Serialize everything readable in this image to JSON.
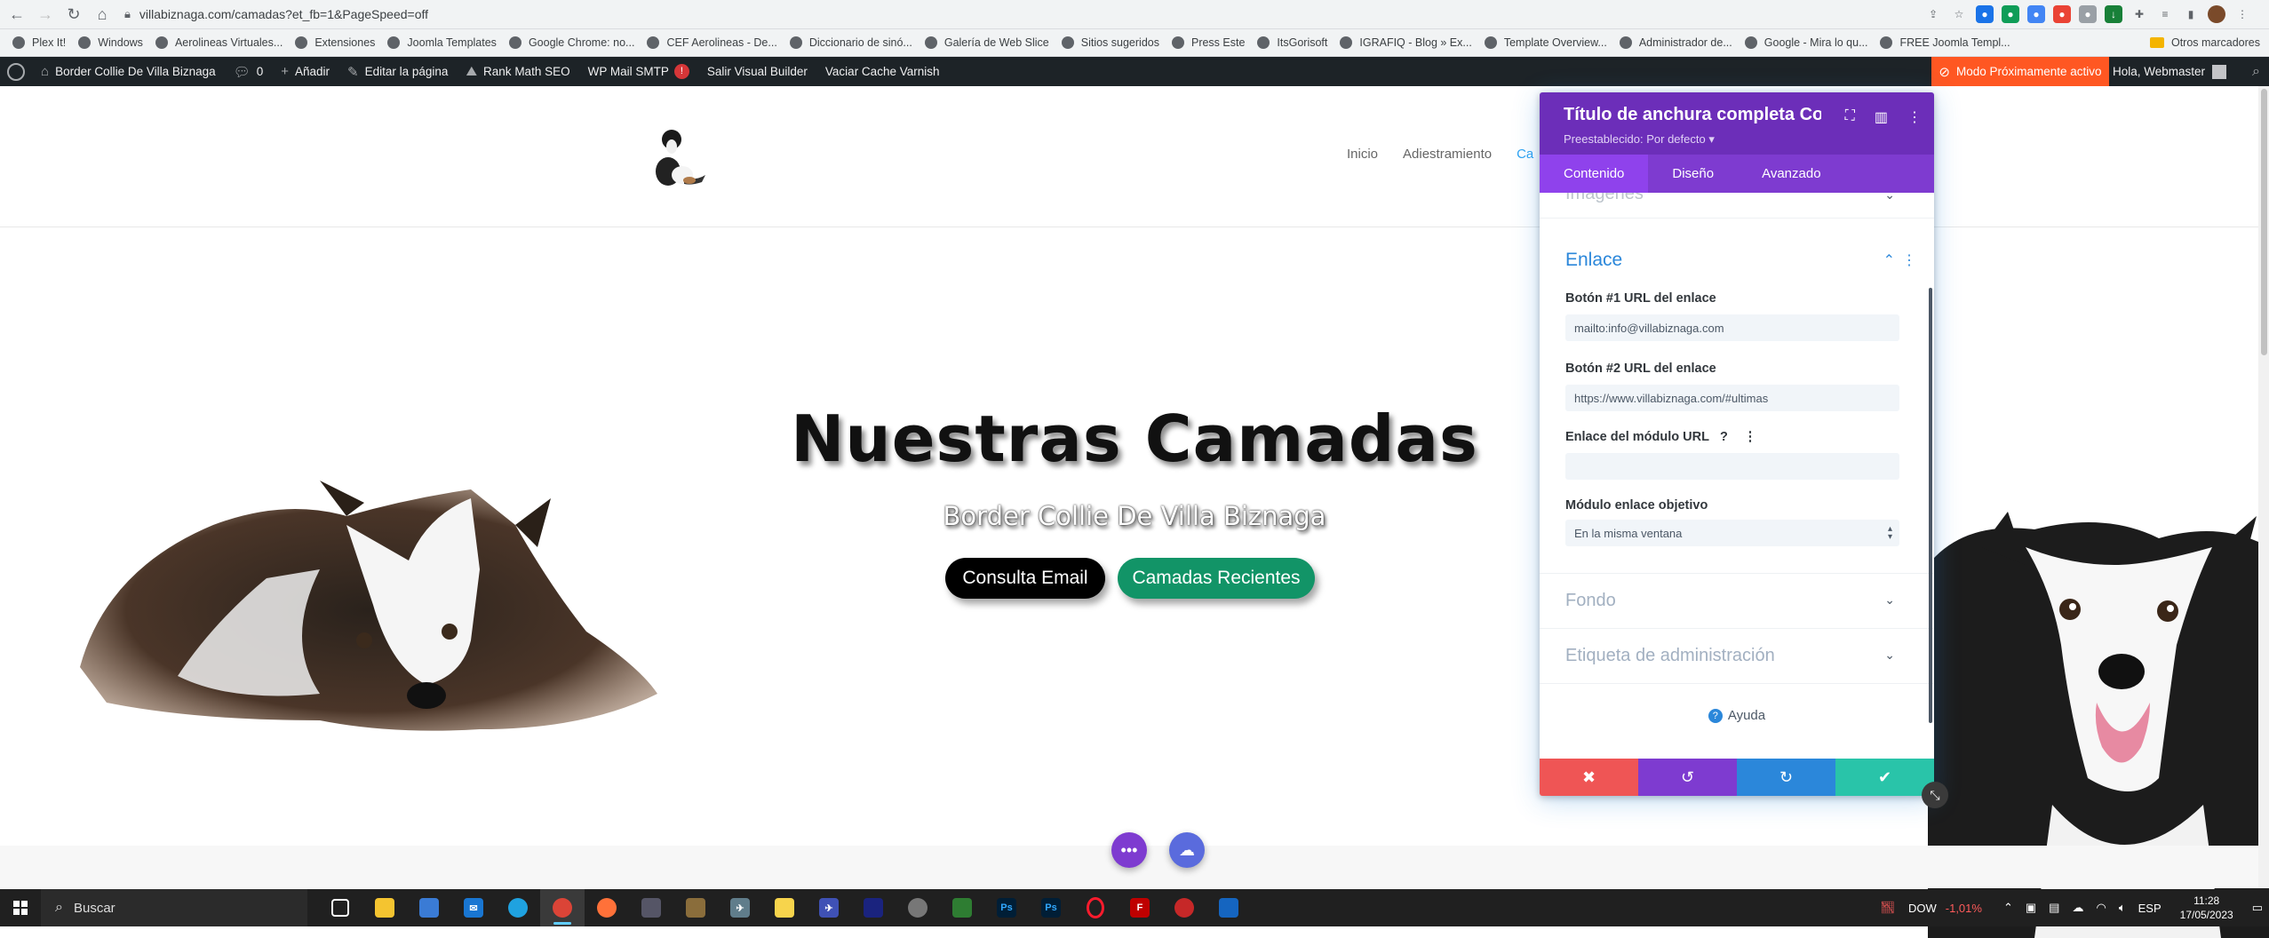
{
  "browser": {
    "url": "villabiznaga.com/camadas?et_fb=1&PageSpeed=off",
    "bookmarks": [
      "Plex It!",
      "Windows",
      "Aerolineas Virtuales...",
      "Extensiones",
      "Joomla Templates",
      "Google Chrome: no...",
      "CEF Aerolineas - De...",
      "Diccionario de sinó...",
      "Galería de Web Slice",
      "Sitios sugeridos",
      "Press Este",
      "ItsGorisoft",
      "IGRAFIQ - Blog » Ex...",
      "Template Overview...",
      "Administrador de...",
      "Google - Mira lo qu...",
      "FREE Joomla Templ..."
    ],
    "other_bookmarks": "Otros marcadores"
  },
  "wpbar": {
    "site_name": "Border Collie De Villa Biznaga",
    "comments_count": "0",
    "add_new": "Añadir",
    "edit_page": "Editar la página",
    "rank_math": "Rank Math SEO",
    "wp_mail": "WP Mail SMTP",
    "wp_mail_badge": "!",
    "exit_builder": "Salir Visual Builder",
    "clear_cache": "Vaciar Cache Varnish",
    "coming_soon": "Modo Próximamente activo",
    "greeting": "Hola, Webmaster"
  },
  "nav": {
    "items": [
      "Inicio",
      "Adiestramiento",
      "Ca"
    ]
  },
  "hero": {
    "title": "Nuestras Camadas",
    "subtitle": "Border Collie De Villa Biznaga",
    "button1": "Consulta Email",
    "button2": "Camadas Recientes"
  },
  "modal": {
    "title": "Título de anchura completa Con...",
    "preset": "Preestablecido: Por defecto ▾",
    "tabs": [
      "Contenido",
      "Diseño",
      "Avanzado"
    ],
    "clipped_section": "Imágenes",
    "section_open": "Enlace",
    "fields": {
      "btn1_label": "Botón #1 URL del enlace",
      "btn1_value": "mailto:info@villabiznaga.com",
      "btn2_label": "Botón #2 URL del enlace",
      "btn2_value": "https://www.villabiznaga.com/#ultimas",
      "module_url_label": "Enlace del módulo URL",
      "module_url_value": "",
      "target_label": "Módulo enlace objetivo",
      "target_value": "En la misma ventana"
    },
    "sections_collapsed": [
      "Fondo",
      "Etiqueta de administración"
    ],
    "help": "Ayuda",
    "colors": {
      "header": "#6c2eb9",
      "tabs": "#7e3bd0",
      "cancel": "#ef5555",
      "undo": "#7e3bd0",
      "redo": "#2b87da",
      "save": "#29c4a9"
    }
  },
  "taskbar": {
    "search_placeholder": "Buscar",
    "stock_name": "DOW",
    "stock_change": "-1,01%",
    "language": "ESP",
    "time": "11:28",
    "date": "17/05/2023"
  }
}
